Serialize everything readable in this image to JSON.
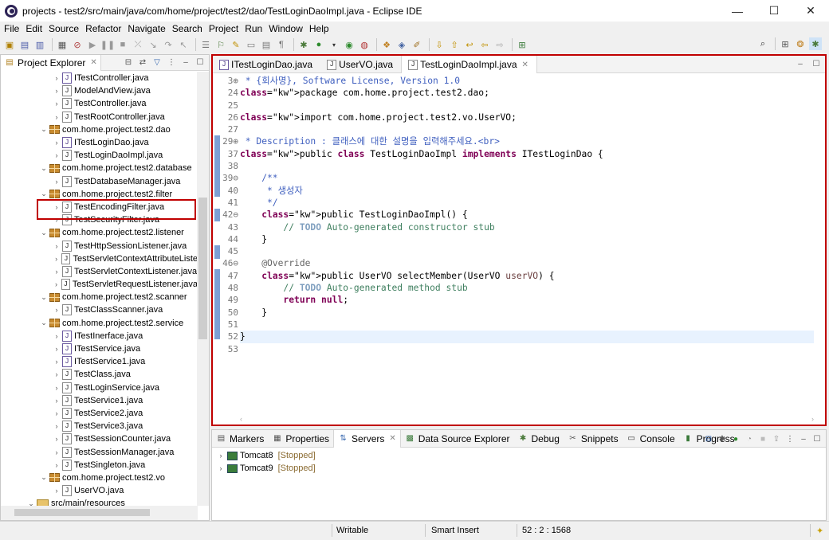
{
  "window": {
    "title": "projects - test2/src/main/java/com/home/project/test2/dao/TestLoginDaoImpl.java - Eclipse IDE",
    "minimize": "—",
    "maximize": "☐",
    "close": "✕"
  },
  "menu": [
    "File",
    "Edit",
    "Source",
    "Refactor",
    "Navigate",
    "Search",
    "Project",
    "Run",
    "Window",
    "Help"
  ],
  "project_explorer": {
    "tab_label": "Project Explorer",
    "items": [
      {
        "label": "ITestController.java",
        "kind": "interface",
        "indent": 3,
        "twisty": "›"
      },
      {
        "label": "ModelAndView.java",
        "kind": "java",
        "indent": 3,
        "twisty": "›"
      },
      {
        "label": "TestController.java",
        "kind": "java",
        "indent": 3,
        "twisty": "›"
      },
      {
        "label": "TestRootController.java",
        "kind": "java",
        "indent": 3,
        "twisty": "›"
      },
      {
        "label": "com.home.project.test2.dao",
        "kind": "package",
        "indent": 2,
        "twisty": "⌄"
      },
      {
        "label": "ITestLoginDao.java",
        "kind": "interface",
        "indent": 3,
        "twisty": "›"
      },
      {
        "label": "TestLoginDaoImpl.java",
        "kind": "java",
        "indent": 3,
        "twisty": "›"
      },
      {
        "label": "com.home.project.test2.database",
        "kind": "package",
        "indent": 2,
        "twisty": "⌄"
      },
      {
        "label": "TestDatabaseManager.java",
        "kind": "java",
        "indent": 3,
        "twisty": "›"
      },
      {
        "label": "com.home.project.test2.filter",
        "kind": "package",
        "indent": 2,
        "twisty": "⌄"
      },
      {
        "label": "TestEncodingFilter.java",
        "kind": "java",
        "indent": 3,
        "twisty": "›"
      },
      {
        "label": "TestSecurityFilter.java",
        "kind": "java",
        "indent": 3,
        "twisty": "›"
      },
      {
        "label": "com.home.project.test2.listener",
        "kind": "package",
        "indent": 2,
        "twisty": "⌄"
      },
      {
        "label": "TestHttpSessionListener.java",
        "kind": "java",
        "indent": 3,
        "twisty": "›"
      },
      {
        "label": "TestServletContextAttributeListe",
        "kind": "java",
        "indent": 3,
        "twisty": "›"
      },
      {
        "label": "TestServletContextListener.java",
        "kind": "java",
        "indent": 3,
        "twisty": "›"
      },
      {
        "label": "TestServletRequestListener.java",
        "kind": "java",
        "indent": 3,
        "twisty": "›"
      },
      {
        "label": "com.home.project.test2.scanner",
        "kind": "package",
        "indent": 2,
        "twisty": "⌄"
      },
      {
        "label": "TestClassScanner.java",
        "kind": "java",
        "indent": 3,
        "twisty": "›"
      },
      {
        "label": "com.home.project.test2.service",
        "kind": "package",
        "indent": 2,
        "twisty": "⌄"
      },
      {
        "label": "ITestInerface.java",
        "kind": "interface",
        "indent": 3,
        "twisty": "›"
      },
      {
        "label": "ITestService.java",
        "kind": "interface",
        "indent": 3,
        "twisty": "›"
      },
      {
        "label": "ITestService1.java",
        "kind": "interface",
        "indent": 3,
        "twisty": "›"
      },
      {
        "label": "TestClass.java",
        "kind": "java",
        "indent": 3,
        "twisty": "›"
      },
      {
        "label": "TestLoginService.java",
        "kind": "java",
        "indent": 3,
        "twisty": "›"
      },
      {
        "label": "TestService1.java",
        "kind": "java",
        "indent": 3,
        "twisty": "›"
      },
      {
        "label": "TestService2.java",
        "kind": "java",
        "indent": 3,
        "twisty": "›"
      },
      {
        "label": "TestService3.java",
        "kind": "java",
        "indent": 3,
        "twisty": "›"
      },
      {
        "label": "TestSessionCounter.java",
        "kind": "java",
        "indent": 3,
        "twisty": "›"
      },
      {
        "label": "TestSessionManager.java",
        "kind": "java",
        "indent": 3,
        "twisty": "›"
      },
      {
        "label": "TestSingleton.java",
        "kind": "java",
        "indent": 3,
        "twisty": "›"
      },
      {
        "label": "com.home.project.test2.vo",
        "kind": "package",
        "indent": 2,
        "twisty": "⌄"
      },
      {
        "label": "UserVO.java",
        "kind": "java",
        "indent": 3,
        "twisty": "›"
      },
      {
        "label": "src/main/resources",
        "kind": "folder",
        "indent": 1,
        "twisty": "⌄"
      }
    ]
  },
  "editor": {
    "tabs": [
      {
        "label": "ITestLoginDao.java",
        "kind": "interface"
      },
      {
        "label": "UserVO.java",
        "kind": "java"
      },
      {
        "label": "TestLoginDaoImpl.java",
        "kind": "java",
        "active": true
      }
    ],
    "line_numbers": [
      "3⊕",
      "24",
      "25",
      "26",
      "27",
      "29⊕",
      "37",
      "38",
      "39⊖",
      "40",
      "41",
      "42⊖",
      "43",
      "44",
      "45",
      "46⊖",
      "47",
      "48",
      "49",
      "50",
      "51",
      "52",
      "53"
    ],
    "lines": [
      " * {회사명}, Software License, Version 1.0",
      "package com.home.project.test2.dao;",
      "",
      "import com.home.project.test2.vo.UserVO;",
      "",
      " * Description : 클래스에 대한 설명을 입력해주세요.<br>",
      "public class TestLoginDaoImpl implements ITestLoginDao {",
      "",
      "    /**",
      "     * 생성자",
      "     */",
      "    public TestLoginDaoImpl() {",
      "        // TODO Auto-generated constructor stub",
      "    }",
      "",
      "    @Override",
      "    public UserVO selectMember(UserVO userVO) {",
      "        // TODO Auto-generated method stub",
      "        return null;",
      "    }",
      "",
      "}",
      ""
    ]
  },
  "bottom_panel": {
    "tabs": [
      {
        "label": "Markers",
        "icon": "markers-icon"
      },
      {
        "label": "Properties",
        "icon": "properties-icon"
      },
      {
        "label": "Servers",
        "icon": "servers-icon",
        "active": true
      },
      {
        "label": "Data Source Explorer",
        "icon": "database-icon"
      },
      {
        "label": "Debug",
        "icon": "bug-icon"
      },
      {
        "label": "Snippets",
        "icon": "snippets-icon"
      },
      {
        "label": "Console",
        "icon": "console-icon"
      },
      {
        "label": "Progress",
        "icon": "progress-icon"
      }
    ],
    "servers": [
      {
        "name": "Tomcat8",
        "status": "[Stopped]"
      },
      {
        "name": "Tomcat9",
        "status": "[Stopped]"
      }
    ]
  },
  "status_bar": {
    "writable": "Writable",
    "insert_mode": "Smart Insert",
    "position": "52 : 2 : 1568"
  },
  "colors": {
    "highlight_border": "#c00000",
    "keyword": "#7f0055",
    "javadoc": "#3f5fbf",
    "comment": "#3f7f5f"
  }
}
